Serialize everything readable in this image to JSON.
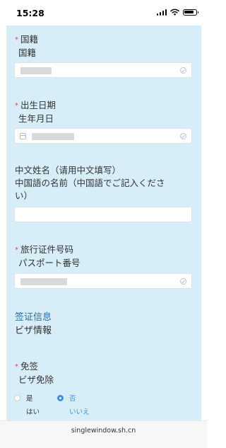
{
  "status_bar": {
    "time": "15:28"
  },
  "form": {
    "nationality": {
      "label_cn": "国籍",
      "label_jp": "国籍",
      "required_mark": "*"
    },
    "birth_date": {
      "label_cn": "出生日期",
      "label_jp": "生年月日",
      "required_mark": "*"
    },
    "chinese_name": {
      "label_cn": "中文姓名（请用中文填写）",
      "label_jp_line1": "中国語の名前（中国語でご記入くださ",
      "label_jp_line2": "い）",
      "value": ""
    },
    "passport_number": {
      "label_cn": "旅行证件号码",
      "label_jp": "パスポート番号",
      "required_mark": "*"
    },
    "visa_section": {
      "title_cn": "签证信息",
      "title_jp": "ビザ情報"
    },
    "visa_exempt": {
      "label_cn": "免签",
      "label_jp": "ビザ免除",
      "required_mark": "*",
      "options": [
        {
          "label_cn": "是",
          "label_jp": "はい",
          "selected": false
        },
        {
          "label_cn": "否",
          "label_jp": "いいえ",
          "selected": true
        }
      ]
    }
  },
  "browser": {
    "url": "singlewindow.sh.cn"
  },
  "colors": {
    "panel_bg": "#d7edf8",
    "accent": "#3b8ee6",
    "required": "#e5484d",
    "section_title": "#2d6fa6"
  }
}
